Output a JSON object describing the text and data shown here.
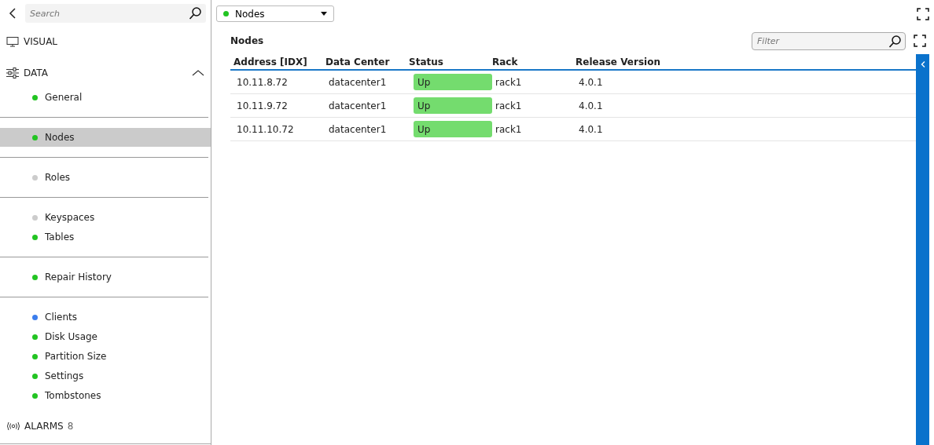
{
  "sidebar": {
    "search": {
      "placeholder": "Search"
    },
    "sections": [
      {
        "kind": "visual",
        "label": "VISUAL"
      },
      {
        "kind": "data",
        "label": "DATA",
        "expanded": true
      }
    ],
    "groups": [
      [
        {
          "label": "General",
          "color": "#22c422",
          "selected": false
        }
      ],
      [
        {
          "label": "Nodes",
          "color": "#22c422",
          "selected": true
        }
      ],
      [
        {
          "label": "Roles",
          "color": "#cccccc",
          "selected": false
        }
      ],
      [
        {
          "label": "Keyspaces",
          "color": "#cccccc",
          "selected": false
        },
        {
          "label": "Tables",
          "color": "#22c422",
          "selected": false
        }
      ],
      [
        {
          "label": "Repair History",
          "color": "#22c422",
          "selected": false
        }
      ],
      [
        {
          "label": "Clients",
          "color": "#3b7ded",
          "selected": false
        },
        {
          "label": "Disk Usage",
          "color": "#22c422",
          "selected": false
        },
        {
          "label": "Partition Size",
          "color": "#22c422",
          "selected": false
        },
        {
          "label": "Settings",
          "color": "#22c422",
          "selected": false
        },
        {
          "label": "Tombstones",
          "color": "#22c422",
          "selected": false
        }
      ]
    ],
    "alarms": {
      "label": "ALARMS",
      "count": "8"
    }
  },
  "selector": {
    "label": "Nodes",
    "color": "#22c422"
  },
  "panel": {
    "title": "Nodes",
    "filter": {
      "placeholder": "Filter"
    },
    "table": {
      "columns": [
        "Address [IDX]",
        "Data Center",
        "Status",
        "Rack",
        "Release Version"
      ],
      "rows": [
        [
          "10.11.8.72",
          "datacenter1",
          "Up",
          "rack1",
          "4.0.1"
        ],
        [
          "10.11.9.72",
          "datacenter1",
          "Up",
          "rack1",
          "4.0.1"
        ],
        [
          "10.11.10.72",
          "datacenter1",
          "Up",
          "rack1",
          "4.0.1"
        ]
      ]
    }
  }
}
